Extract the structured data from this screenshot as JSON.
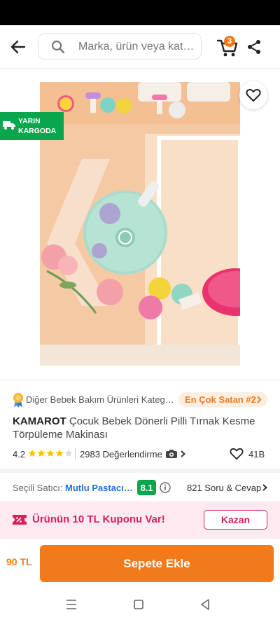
{
  "header": {
    "search_placeholder": "Marka, ürün veya kate…",
    "cart_count": "3"
  },
  "product": {
    "cargo_badge": [
      "YARIN",
      "KARGODA"
    ],
    "image_alt": "Çocuk bebek dönerli pilli tırnak kesme törpüleme makinası",
    "category": "Diğer Bebek Bakım Ürünleri Kateg…",
    "bestseller": "En Çok Satan #2",
    "brand": "KAMAROT",
    "name": "Çocuk Bebek Dönerli Pilli Tırnak Kesme Törpüleme Makinası",
    "rating": "4.2",
    "stars_filled": 4,
    "review_count": "2983 Değerlendirme",
    "like_count": "41B"
  },
  "seller": {
    "label": "Seçili Satıcı:",
    "name": "Mutlu Pastacılı…",
    "score": "8.1",
    "qa": "821 Soru & Cevap"
  },
  "coupon": {
    "text": "Ürünün 10 TL Kuponu Var!",
    "button": "Kazan"
  },
  "purchase": {
    "price": "90 TL",
    "add_to_cart": "Sepete Ekle"
  },
  "colors": {
    "accent": "#f27a1a",
    "green": "#0aa64d",
    "coupon_pink": "#d6215b",
    "seller_blue": "#1a73e8"
  }
}
